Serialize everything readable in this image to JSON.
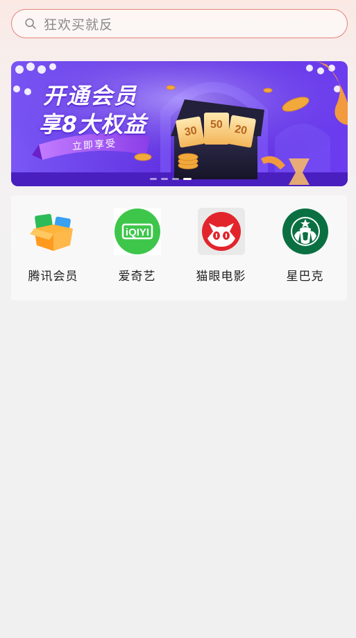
{
  "search": {
    "placeholder": "狂欢买就反"
  },
  "banner": {
    "title_line1": "开通会员",
    "title_line2": "享8大权益",
    "cta": "立即享受",
    "ticket_values": [
      "30",
      "50",
      "20"
    ],
    "dots": 4,
    "active_dot": 3
  },
  "grid": {
    "items": [
      {
        "label": "腾讯会员",
        "icon": "tencent-video-icon"
      },
      {
        "label": "爱奇艺",
        "icon": "iqiyi-icon"
      },
      {
        "label": "猫眼电影",
        "icon": "maoyan-icon"
      },
      {
        "label": "星巴克",
        "icon": "starbucks-icon"
      }
    ]
  },
  "colors": {
    "search_border": "#e3837a",
    "banner_purple": "#6a3cf0",
    "iqiyi_green": "#3ec64b",
    "maoyan_red": "#e2252c",
    "starbucks_green": "#0a7042"
  }
}
